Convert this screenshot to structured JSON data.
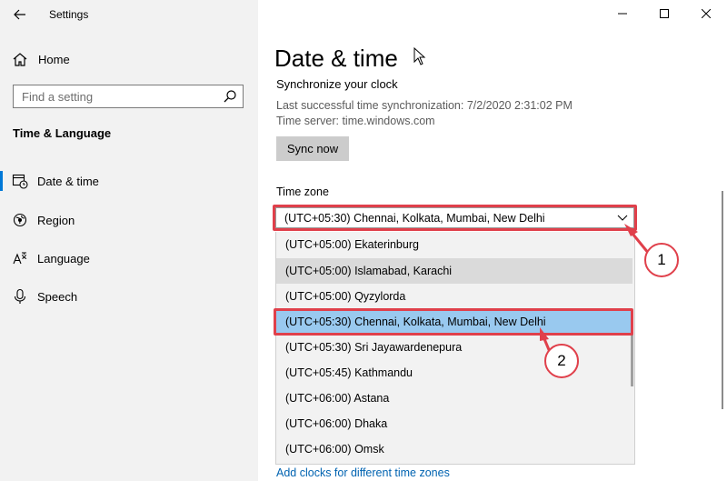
{
  "window": {
    "app_title": "Settings",
    "minimize_icon": "minimize-icon",
    "maximize_icon": "maximize-icon",
    "close_icon": "close-icon"
  },
  "sidebar": {
    "home_label": "Home",
    "search_placeholder": "Find a setting",
    "section_heading": "Time & Language",
    "items": [
      {
        "label": "Date & time",
        "icon": "calendar-clock-icon",
        "active": true
      },
      {
        "label": "Region",
        "icon": "globe-icon",
        "active": false
      },
      {
        "label": "Language",
        "icon": "language-icon",
        "active": false
      },
      {
        "label": "Speech",
        "icon": "microphone-icon",
        "active": false
      }
    ]
  },
  "main": {
    "page_title": "Date & time",
    "sync": {
      "heading": "Synchronize your clock",
      "last_sync": "Last successful time synchronization: 7/2/2020 2:31:02 PM",
      "server": "Time server: time.windows.com",
      "button_label": "Sync now"
    },
    "time_zone": {
      "label": "Time zone",
      "selected_value": "(UTC+05:30) Chennai, Kolkata, Mumbai, New Delhi",
      "options": [
        "(UTC+05:00) Ekaterinburg",
        "(UTC+05:00) Islamabad, Karachi",
        "(UTC+05:00) Qyzylorda",
        "(UTC+05:30) Chennai, Kolkata, Mumbai, New Delhi",
        "(UTC+05:30) Sri Jayawardenepura",
        "(UTC+05:45) Kathmandu",
        "(UTC+06:00) Astana",
        "(UTC+06:00) Dhaka",
        "(UTC+06:00) Omsk"
      ],
      "hovered_index": 1,
      "selected_index": 3
    },
    "add_clocks_link": "Add clocks for different time zones"
  },
  "annotations": {
    "callout_1": "1",
    "callout_2": "2",
    "highlight_color": "#e0404b"
  },
  "colors": {
    "accent": "#0078d7",
    "selected_option": "#99c9ef",
    "link": "#0063b1"
  }
}
